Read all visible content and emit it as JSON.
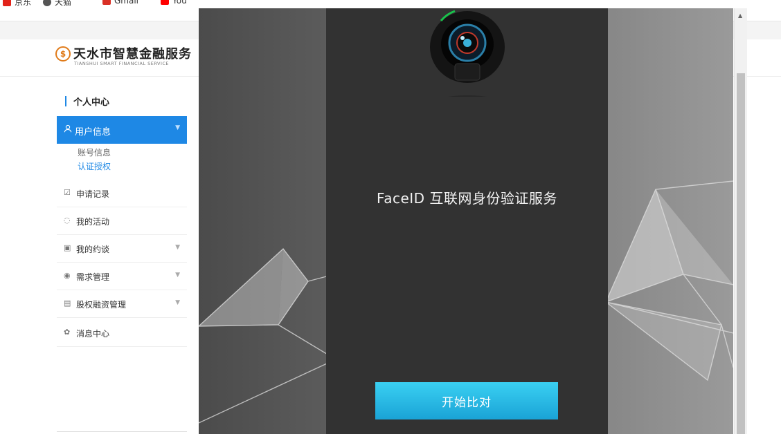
{
  "bookmarks": [
    {
      "label": "京东",
      "color": "#e2231a"
    },
    {
      "label": "天猫",
      "color": "#555555"
    },
    {
      "label": "Gmail",
      "color": "#d93025"
    },
    {
      "label": "You",
      "color": "#ff0000"
    }
  ],
  "header": {
    "logo_cn": "天水市智慧金融服务",
    "logo_en": "TIANSHUI SMART FINANCIAL SERVICE"
  },
  "sidebar": {
    "title": "个人中心",
    "active_item": {
      "label": "用户信息",
      "icon": "user-icon"
    },
    "subitems": [
      {
        "label": "账号信息",
        "color": "#666666"
      },
      {
        "label": "认证授权",
        "color": "#1e88e5"
      }
    ],
    "items": [
      {
        "label": "申请记录",
        "icon": "edit-icon",
        "glyph": "☑",
        "has_caret": false
      },
      {
        "label": "我的活动",
        "icon": "chat-icon",
        "glyph": "◌",
        "has_caret": false
      },
      {
        "label": "我的约谈",
        "icon": "calendar-icon",
        "glyph": "▣",
        "has_caret": true
      },
      {
        "label": "需求管理",
        "icon": "comment-icon",
        "glyph": "◉",
        "has_caret": true
      },
      {
        "label": "股权融资管理",
        "icon": "document-icon",
        "glyph": "▤",
        "has_caret": true
      },
      {
        "label": "消息中心",
        "icon": "settings-icon",
        "glyph": "✿",
        "has_caret": false
      }
    ]
  },
  "modal": {
    "title": "FaceID 互联网身份验证服务",
    "button_label": "开始比对",
    "accent_color": "#22b8e6"
  }
}
